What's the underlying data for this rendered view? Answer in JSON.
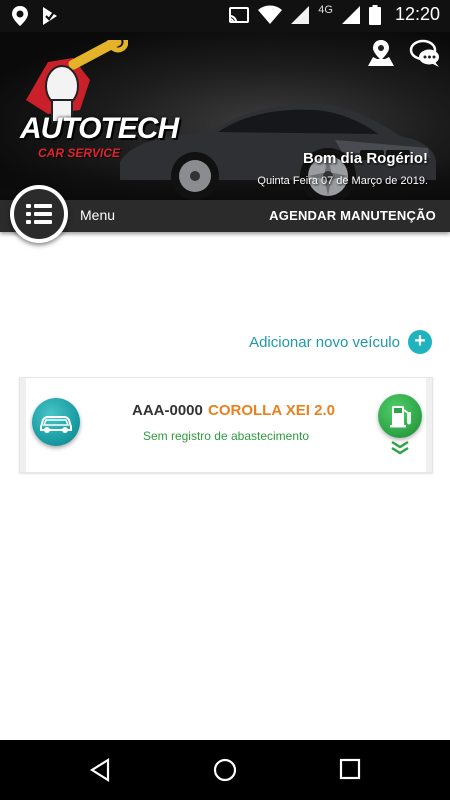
{
  "status_bar": {
    "time": "12:20",
    "network": "4G",
    "icons": [
      "location-icon",
      "download-check-icon",
      "cast-icon",
      "wifi-icon",
      "signal-icon",
      "battery-icon"
    ]
  },
  "header": {
    "logo_text": "AUTOTECH",
    "logo_subtitle": "CAR SERVICE",
    "greeting": "Bom dia Rogério!",
    "date": "Quinta Feira 07 de Março de 2019.",
    "actions": [
      "map-location-icon",
      "chat-icon"
    ]
  },
  "menu": {
    "label": "Menu",
    "schedule_label": "AGENDAR MANUTENÇÃO"
  },
  "vehicles": {
    "add_label": "Adicionar novo veículo",
    "items": [
      {
        "plate": "AAA-0000",
        "model": "COROLLA XEI 2.0",
        "status": "Sem registro de abastecimento"
      }
    ]
  },
  "colors": {
    "teal": "#1fb2bf",
    "orange": "#e8811f",
    "green": "#2e9a3c",
    "dark_bar": "#2b2b2b"
  }
}
